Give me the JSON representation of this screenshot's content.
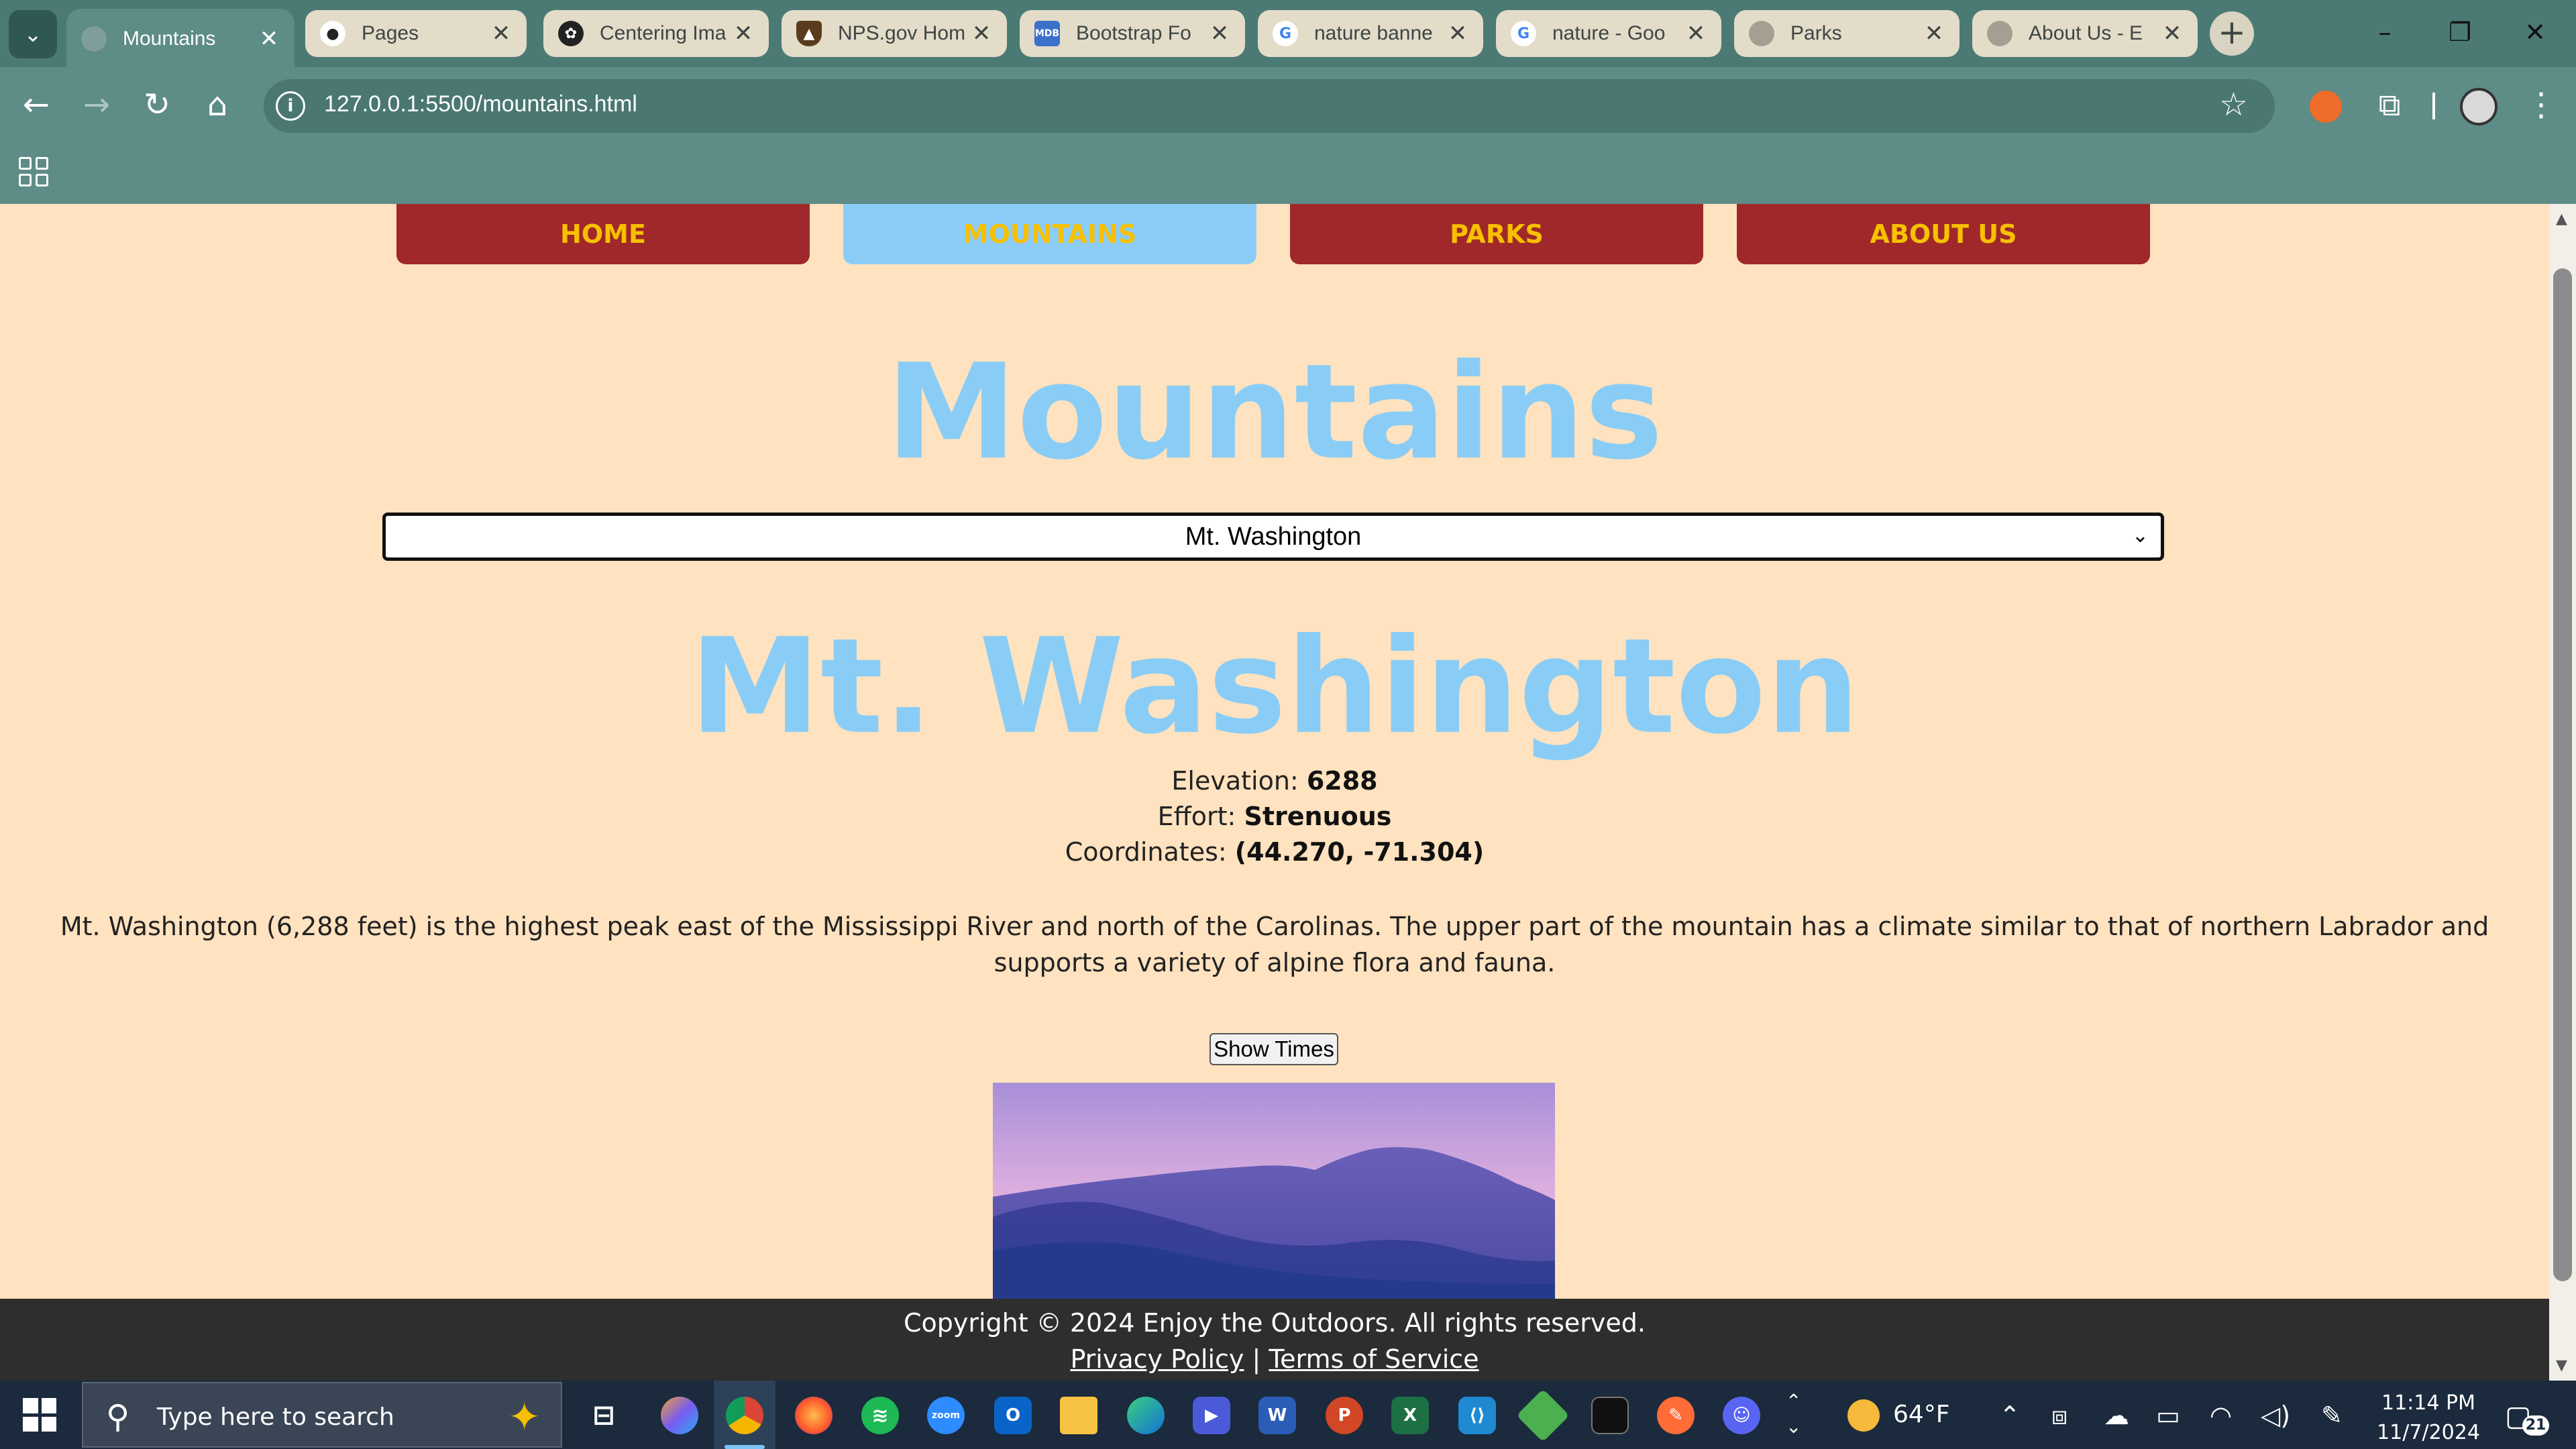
{
  "tabs": [
    {
      "title": "Mountains",
      "favicon": "globe-icon",
      "active": true
    },
    {
      "title": "Pages",
      "favicon": "github-icon"
    },
    {
      "title": "Centering Ima",
      "favicon": "openai-icon"
    },
    {
      "title": "NPS.gov Hom",
      "favicon": "nps-icon"
    },
    {
      "title": "Bootstrap Fo",
      "favicon": "mdb-icon"
    },
    {
      "title": "nature banne",
      "favicon": "google-icon"
    },
    {
      "title": "nature - Goo",
      "favicon": "google-icon"
    },
    {
      "title": "Parks",
      "favicon": "globe-icon"
    },
    {
      "title": "About Us - E",
      "favicon": "globe-icon"
    }
  ],
  "browser": {
    "url": "127.0.0.1:5500/mountains.html",
    "new_tab": "+",
    "minimize": "–",
    "restore": "❐",
    "close": "✕"
  },
  "nav": {
    "home": "HOME",
    "mountains": "MOUNTAINS",
    "parks": "PARKS",
    "about": "ABOUT US",
    "current": "mountains"
  },
  "page": {
    "heading": "Mountains",
    "select_value": "Mt. Washington",
    "mountain_name": "Mt. Washington",
    "elevation_label": "Elevation:",
    "elevation_value": "6288",
    "effort_label": "Effort:",
    "effort_value": "Strenuous",
    "coords_label": "Coordinates:",
    "coords_value": "(44.270, -71.304)",
    "description": "Mt. Washington (6,288 feet) is the highest peak east of the Mississippi River and north of the Carolinas. The upper part of the mountain has a climate similar to that of northern Labrador and supports a variety of alpine flora and fauna.",
    "show_times": "Show Times"
  },
  "footer": {
    "copyright": "Copyright © 2024 Enjoy the Outdoors. All rights reserved.",
    "privacy": "Privacy Policy",
    "separator": "|",
    "terms": "Terms of Service"
  },
  "taskbar": {
    "search_placeholder": "Type here to search",
    "temperature": "64°F",
    "time": "11:14 PM",
    "date": "11/7/2024",
    "notification_count": "21"
  },
  "colors": {
    "page_bg": "#ffe2bf",
    "nav_btn": "#a0282a",
    "nav_text": "#f7c000",
    "nav_current": "#8ccdf7",
    "heading": "#89cdf7",
    "footer_bg": "#2e2e2e"
  }
}
